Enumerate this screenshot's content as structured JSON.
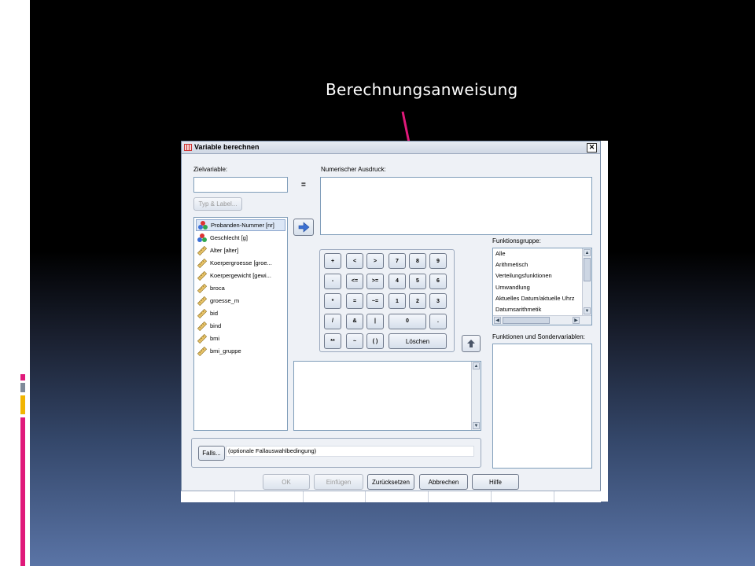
{
  "slide": {
    "caption": "Berechnungsanweisung",
    "accent_color": "#e0197a",
    "arrow_icon": "pink-arrow-icon"
  },
  "dialog": {
    "title": "Variable berechnen",
    "target_label": "Zielvariable:",
    "target_value": "",
    "type_label_button": "Typ & Label...",
    "expression_label": "Numerischer Ausdruck:",
    "expression_value": "",
    "equals_sign": "=",
    "variables": [
      {
        "label": "Probanden-Nummer [nr]",
        "icon": "nominal-icon",
        "selected": true
      },
      {
        "label": "Geschlecht [g]",
        "icon": "nominal-icon",
        "selected": false
      },
      {
        "label": "Alter [alter]",
        "icon": "scale-ruler-icon",
        "selected": false
      },
      {
        "label": "Koerpergroesse [groe...",
        "icon": "scale-ruler-icon",
        "selected": false
      },
      {
        "label": "Koerpergewicht [gewi...",
        "icon": "scale-ruler-icon",
        "selected": false
      },
      {
        "label": "broca",
        "icon": "scale-ruler-icon",
        "selected": false
      },
      {
        "label": "groesse_m",
        "icon": "scale-ruler-icon",
        "selected": false
      },
      {
        "label": "bid",
        "icon": "scale-ruler-icon",
        "selected": false
      },
      {
        "label": "bind",
        "icon": "scale-ruler-icon",
        "selected": false
      },
      {
        "label": "bmi",
        "icon": "scale-ruler-icon",
        "selected": false
      },
      {
        "label": "bmi_gruppe",
        "icon": "scale-ruler-icon",
        "selected": false
      }
    ],
    "calculator": {
      "row1": [
        "+",
        "<",
        ">",
        "7",
        "8",
        "9"
      ],
      "row2": [
        "-",
        "<=",
        ">=",
        "4",
        "5",
        "6"
      ],
      "row3": [
        "*",
        "=",
        "~=",
        "1",
        "2",
        "3"
      ],
      "row4": [
        "/",
        "&",
        "|",
        "0",
        "."
      ],
      "row5": [
        "**",
        "~",
        "( )",
        "Löschen"
      ]
    },
    "function_group_label": "Funktionsgruppe:",
    "function_groups": [
      "Alle",
      "Arithmetisch",
      "Verteilungsfunktionen",
      "Umwandlung",
      "Aktuelles Datum/aktuelle Uhrz",
      "Datumsarithmetik"
    ],
    "functions_label": "Funktionen und Sondervariablen:",
    "if_button": "Falls...",
    "if_text": "(optionale Fallauswahlbedingung)",
    "buttons": {
      "ok": "OK",
      "paste": "Einfügen",
      "reset": "Zurücksetzen",
      "cancel": "Abbrechen",
      "help": "Hilfe"
    }
  }
}
